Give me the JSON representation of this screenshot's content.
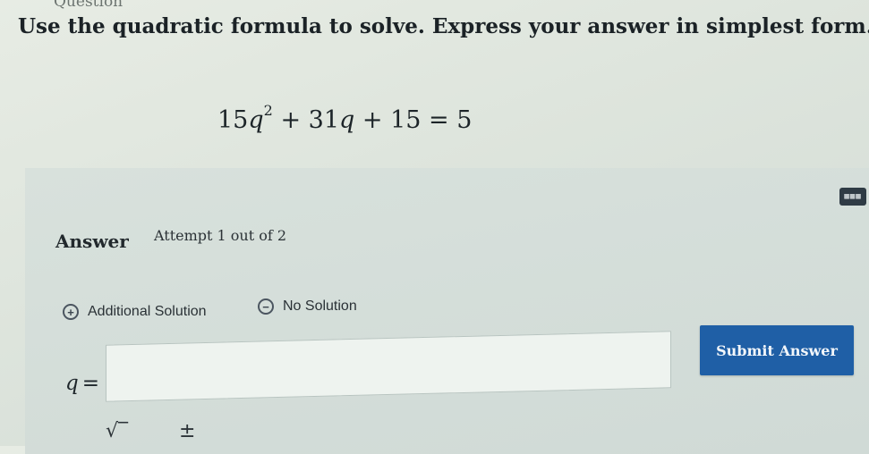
{
  "header": {
    "section_label": "Question",
    "instruction": "Use the quadratic formula to solve. Express your answer in simplest form."
  },
  "equation": {
    "coef_a": "15",
    "variable": "q",
    "exponent": "2",
    "term_b": "+ 31",
    "term_c": "+ 15 = 5"
  },
  "answer": {
    "label": "Answer",
    "attempt": "Attempt 1 out of 2",
    "options": {
      "additional_solution": "Additional Solution",
      "no_solution": "No Solution"
    },
    "variable_label": "q",
    "equals": "=",
    "input_value": "",
    "submit_label": "Submit Answer"
  },
  "toolbar": {
    "sqrt_symbol": "√‾",
    "plus_minus_symbol": "±",
    "keyboard_icon": "▦▦▦"
  },
  "colors": {
    "submit_button": "#1f5fa6",
    "background": "#dde4dc"
  }
}
